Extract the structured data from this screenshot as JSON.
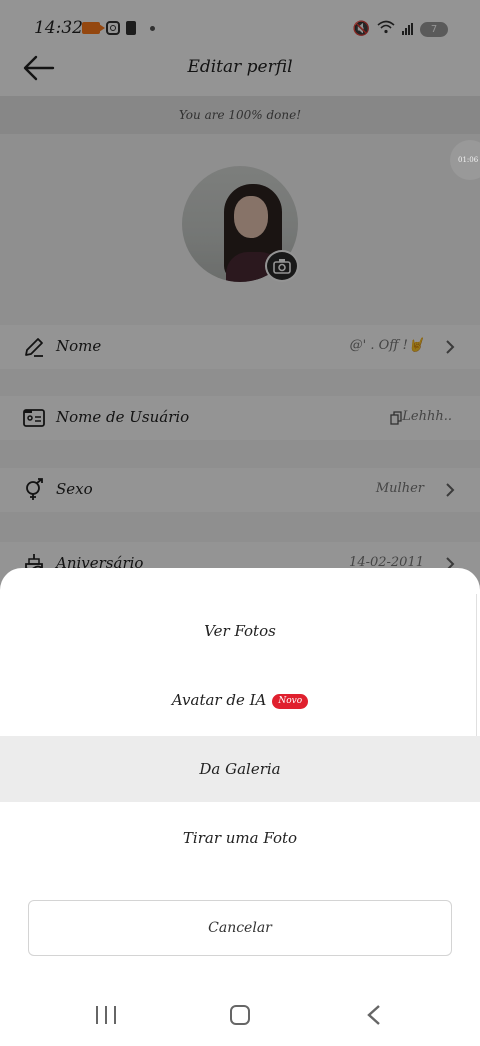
{
  "status_bar": {
    "time": "14:32",
    "battery": "7"
  },
  "header": {
    "title": "Editar perfil"
  },
  "progress_banner": "You are 100% done!",
  "timer_bubble": "01:06",
  "rows": [
    {
      "label": "Nome",
      "value": "@' . Off !🤘",
      "icon": "pencil-icon",
      "chevron": true
    },
    {
      "label": "Nome de Usuário",
      "value": "Lehhh..",
      "icon": "id-card-icon",
      "chevron": false
    },
    {
      "label": "Sexo",
      "value": "Mulher",
      "icon": "gender-icon",
      "chevron": true
    },
    {
      "label": "Aniversário",
      "value": "14-02-2011",
      "icon": "cake-icon",
      "chevron": true
    }
  ],
  "sheet": {
    "items": [
      {
        "label": "Ver Fotos",
        "badge": ""
      },
      {
        "label": "Avatar de IA",
        "badge": "Novo"
      },
      {
        "label": "Da Galeria",
        "badge": ""
      },
      {
        "label": "Tirar uma Foto",
        "badge": ""
      }
    ],
    "selected_index": 2,
    "cancel_label": "Cancelar"
  },
  "colors": {
    "badge": "#e0202e",
    "recording": "#ff7a1a",
    "overlay": "rgba(0,0,0,0.42)"
  }
}
